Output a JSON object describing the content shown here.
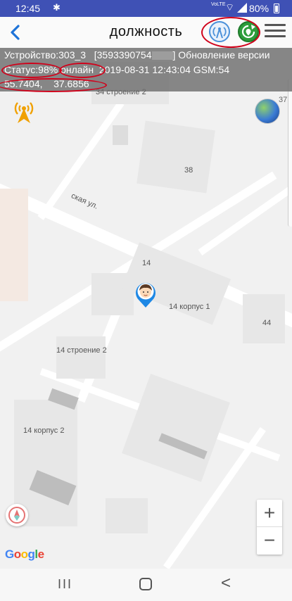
{
  "status_bar": {
    "time": "12:45",
    "notification_icon": "bug-icon",
    "network": "VoLTE",
    "battery": "80%"
  },
  "app_bar": {
    "title": "должность",
    "back_icon": "back-arrow-icon",
    "tower_icon": "cell-tower-icon",
    "locate_icon": "refresh-location-icon",
    "menu_icon": "hamburger-menu-icon"
  },
  "info": {
    "device_label": "Устройство:",
    "device_value": "303_3",
    "imei_partial": "[3593390754",
    "imei_close": "]",
    "update_label": "Обновление версии",
    "status_label": "Статус:",
    "status_value": "98%",
    "online": "онлайн",
    "datetime": "2019-08-31 12:43:04",
    "gsm": "GSM:54",
    "lat": "55.7404",
    "lng": "37.6856"
  },
  "map": {
    "labels": {
      "building_34_2": "34 строение 2",
      "n37": "37",
      "n38": "38",
      "street": "ская ул.",
      "n14": "14",
      "korpus1": "14 корпус 1",
      "n44": "44",
      "stroenie2": "14 строение 2",
      "korpus2": "14 корпус 2"
    },
    "attribution": "Google",
    "zoom_in": "+",
    "zoom_out": "−"
  },
  "nav_bar": {
    "recent": "III",
    "back": "<"
  },
  "colors": {
    "status_bar": "#3f51b5",
    "highlight": "#d0021b",
    "marker": "#1e88e5"
  }
}
